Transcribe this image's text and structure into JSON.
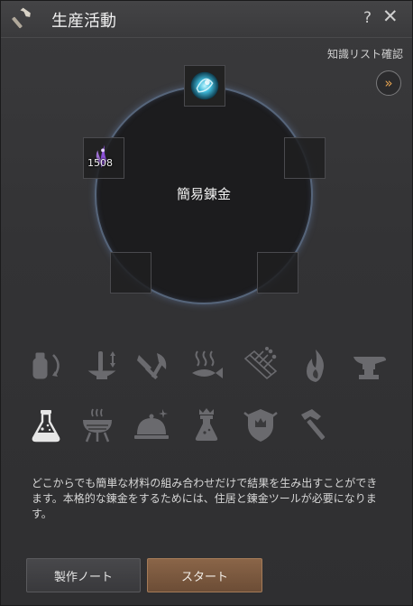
{
  "window": {
    "title": "生産活動",
    "help_label": "?",
    "close_label": "✕",
    "icon": "hammer-icon"
  },
  "header": {
    "knowledge_link_label": "知識リスト確認",
    "forward_icon": "double-chevron-right-icon",
    "forward_glyph": "»"
  },
  "crafting": {
    "circle_label": "簡易錬金",
    "slots": [
      {
        "position": "top",
        "item": "blue-crystal-item",
        "count": ""
      },
      {
        "position": "left",
        "item": "purple-herb-item",
        "count": "1508"
      },
      {
        "position": "right",
        "item": "",
        "count": ""
      },
      {
        "position": "bottom-left",
        "item": "",
        "count": ""
      },
      {
        "position": "bottom-right",
        "item": "",
        "count": ""
      }
    ]
  },
  "activities": [
    {
      "name": "shaking-icon",
      "selected": false
    },
    {
      "name": "grinding-icon",
      "selected": false
    },
    {
      "name": "chopping-icon",
      "selected": false
    },
    {
      "name": "drying-icon",
      "selected": false
    },
    {
      "name": "filtering-icon",
      "selected": false
    },
    {
      "name": "heating-icon",
      "selected": false
    },
    {
      "name": "anvil-icon",
      "selected": false
    },
    {
      "name": "alchemy-flask-icon",
      "selected": true
    },
    {
      "name": "cooking-grill-icon",
      "selected": false
    },
    {
      "name": "simple-cooking-icon",
      "selected": false
    },
    {
      "name": "imperial-alchemy-icon",
      "selected": false
    },
    {
      "name": "guild-crest-icon",
      "selected": false
    },
    {
      "name": "repair-hammer-icon",
      "selected": false
    }
  ],
  "description": "どこからでも簡単な材料の組み合わせだけで結果を生み出すことができます。本格的な錬金をするためには、住居と錬金ツールが必要になります。",
  "buttons": {
    "note_label": "製作ノート",
    "start_label": "スタート"
  },
  "colors": {
    "accent": "#e0a050",
    "start_button": "#7a5840",
    "circle_border": "#56657a",
    "icon_inactive": "#6a6a6e",
    "icon_active": "#e6e6e6"
  }
}
